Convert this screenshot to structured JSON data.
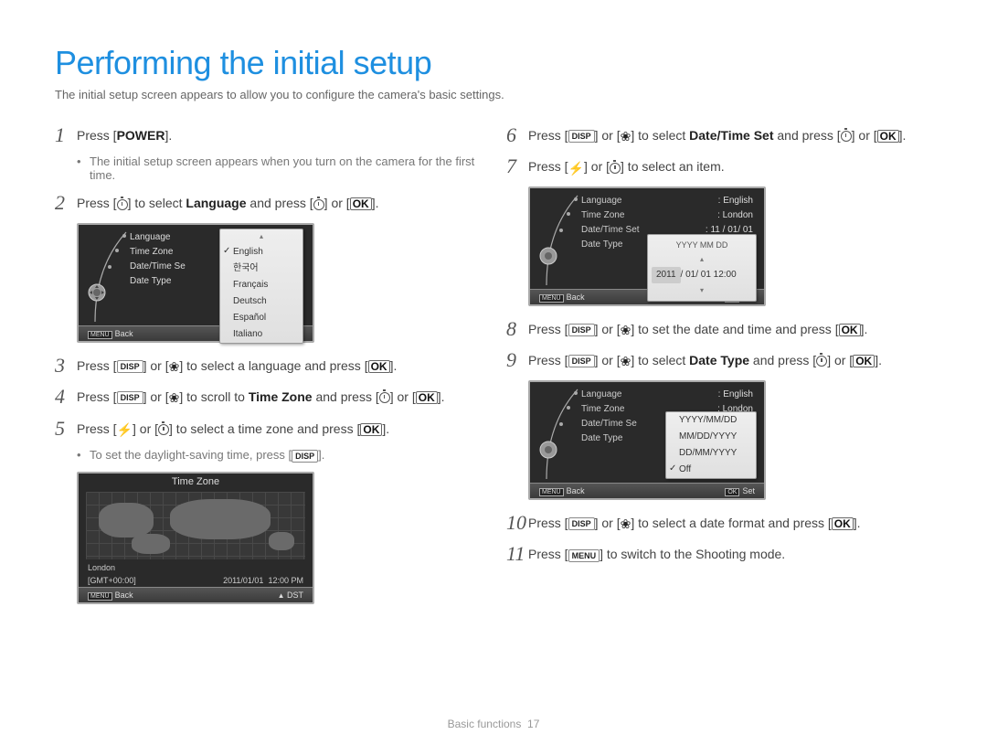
{
  "title": "Performing the initial setup",
  "subtitle": "The initial setup screen appears to allow you to configure the camera's basic settings.",
  "labels": {
    "power": "POWER",
    "disp": "DISP",
    "ok": "OK",
    "menu": "MENU",
    "back": "Back",
    "set": "Set",
    "dst": "DST"
  },
  "steps_left": {
    "s1": {
      "num": "1",
      "text_a": "Press [",
      "text_b": "]."
    },
    "s1_note": "The initial setup screen appears when you turn on the camera for the first time.",
    "s2": {
      "num": "2",
      "text_a": "Press [",
      "text_b": "] to select ",
      "bold": "Language",
      "text_c": " and press [",
      "text_d": "] or [",
      "text_e": "]."
    },
    "s3": {
      "num": "3",
      "text_a": "Press [",
      "text_b": "] or [",
      "text_c": "] to select a language and press [",
      "text_d": "]."
    },
    "s4": {
      "num": "4",
      "text_a": "Press [",
      "text_b": "] or [",
      "text_c": "] to scroll to ",
      "bold": "Time Zone",
      "text_d": " and press [",
      "text_e": "] or [",
      "text_f": "]."
    },
    "s5": {
      "num": "5",
      "text_a": "Press [",
      "text_b": "] or [",
      "text_c": "] to select a time zone and press [",
      "text_d": "]."
    },
    "s5_note_a": "To set the daylight-saving time, press [",
    "s5_note_b": "]."
  },
  "steps_right": {
    "s6": {
      "num": "6",
      "text_a": "Press [",
      "text_b": "] or [",
      "text_c": "] to select ",
      "bold": "Date/Time Set",
      "text_d": " and press [",
      "text_e": "] or [",
      "text_f": "]."
    },
    "s7": {
      "num": "7",
      "text_a": "Press [",
      "text_b": "] or [",
      "text_c": "] to select an item."
    },
    "s8": {
      "num": "8",
      "text_a": "Press [",
      "text_b": "] or [",
      "text_c": "] to set the date and time and press [",
      "text_d": "]."
    },
    "s9": {
      "num": "9",
      "text_a": "Press [",
      "text_b": "] or [",
      "text_c": "] to select ",
      "bold": "Date Type",
      "text_d": " and press [",
      "text_e": "] or [",
      "text_f": "]."
    },
    "s10": {
      "num": "10",
      "text_a": "Press [",
      "text_b": "] or [",
      "text_c": "] to select a date format and press [",
      "text_d": "]."
    },
    "s11": {
      "num": "11",
      "text_a": "Press [",
      "text_b": "] to switch to the Shooting mode."
    }
  },
  "lcd_lang": {
    "items": [
      "Language",
      "Time Zone",
      "Date/Time Se",
      "Date Type"
    ],
    "options": [
      "English",
      "한국어",
      "Français",
      "Deutsch",
      "Español",
      "Italiano"
    ]
  },
  "lcd_tz": {
    "title": "Time Zone",
    "city": "London",
    "gmt": "[GMT+00:00]",
    "date": "2011/01/01",
    "time": "12:00 PM"
  },
  "lcd_dt": {
    "rows": [
      [
        "Language",
        ": English"
      ],
      [
        "Time Zone",
        ": London"
      ],
      [
        "Date/Time Set",
        ": 11 / 01/ 01"
      ],
      [
        "Date Type",
        ""
      ]
    ],
    "fmt_label": "YYYY MM DD",
    "sel": "2011",
    "rest": "/ 01/ 01  12:00"
  },
  "lcd_type": {
    "rows": [
      [
        "Language",
        ": English"
      ],
      [
        "Time Zone",
        ": London"
      ],
      [
        "Date/Time Se",
        ""
      ],
      [
        "Date Type",
        ""
      ]
    ],
    "options": [
      "YYYY/MM/DD",
      "MM/DD/YYYY",
      "DD/MM/YYYY",
      "Off"
    ]
  },
  "footer": {
    "section": "Basic functions",
    "page": "17"
  }
}
